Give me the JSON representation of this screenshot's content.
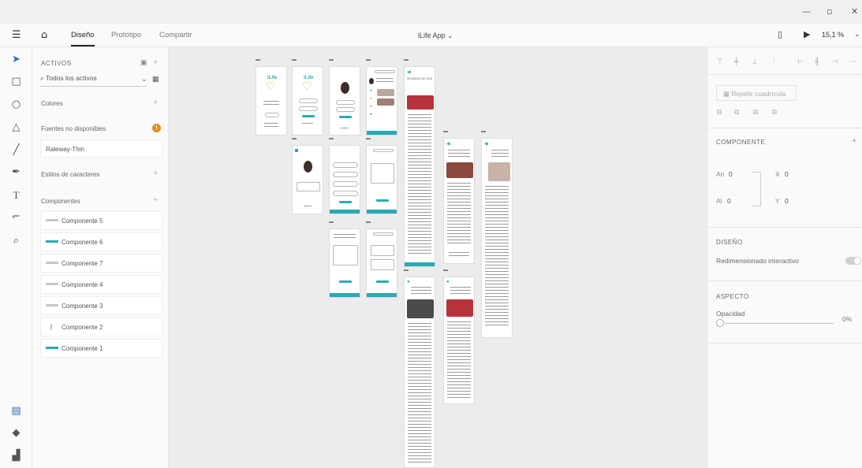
{
  "window": {
    "minimize": "—",
    "restore": "▫",
    "close": "✕"
  },
  "appbar": {
    "tabs": [
      "Diseño",
      "Prototipo",
      "Compartir"
    ],
    "doc_title": "iLife App",
    "zoom": "15,1 %"
  },
  "assets": {
    "header": "ACTIVOS",
    "search_value": "Todos los activos",
    "colores": "Colores",
    "fuentes_no_disponibles": "Fuentes no disponibles",
    "font_missing": "Raleway-Thin",
    "estilos": "Estilos de caracteres",
    "componentes": "Componentes",
    "components": [
      {
        "label": "Componente 5",
        "thumb": "grey"
      },
      {
        "label": "Componente 6",
        "thumb": "teal"
      },
      {
        "label": "Componente 7",
        "thumb": "grey"
      },
      {
        "label": "Componente 4",
        "thumb": "grey"
      },
      {
        "label": "Componente 3",
        "thumb": "grey"
      },
      {
        "label": "Componente 2",
        "thumb": "grey"
      },
      {
        "label": "Componente 1",
        "thumb": "teal"
      }
    ]
  },
  "props": {
    "repeat_grid": "Repetir cuadrícula",
    "componente": "COMPONENTE",
    "an_label": "An",
    "an_value": "0",
    "al_label": "Al",
    "al_value": "0",
    "x_label": "X",
    "x_value": "0",
    "y_label": "Y",
    "y_value": "0",
    "diseno": "DISEÑO",
    "redimensionado": "Redimensionado interactivo",
    "aspecto": "ASPECTO",
    "opacidad": "Opacidad",
    "opacidad_value": "0%"
  },
  "artboards": {
    "logo_text": "iLife",
    "headline": "SEMANAS DE VIDA"
  },
  "colors": {
    "accent": "#2aa9b5",
    "warning": "#e58d1e"
  }
}
